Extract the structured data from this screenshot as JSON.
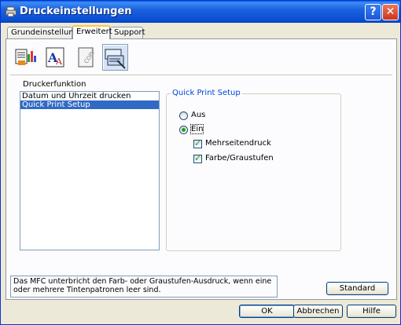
{
  "window": {
    "title": "Druckeinstellungen",
    "help_button": "?",
    "close_button": "✕"
  },
  "tabs": [
    {
      "label": "Grundeinstellungen",
      "active": false
    },
    {
      "label": "Erweitert",
      "active": true
    },
    {
      "label": "Support",
      "active": false
    }
  ],
  "toolbar_icons": [
    {
      "name": "printer-settings-icon",
      "selected": false
    },
    {
      "name": "font-text-icon",
      "selected": false
    },
    {
      "name": "copy-watermark-icon",
      "selected": false
    },
    {
      "name": "device-options-icon",
      "selected": true
    }
  ],
  "function_list": {
    "label": "Druckerfunktion",
    "items": [
      {
        "label": "Datum und Uhrzeit drucken",
        "selected": false
      },
      {
        "label": "Quick Print Setup",
        "selected": true
      }
    ]
  },
  "quick_print": {
    "group_title": "Quick Print Setup",
    "radio_off": "Aus",
    "radio_on": "Ein",
    "selected": "Ein",
    "check_multipage": "Mehrseitendruck",
    "check_multipage_checked": true,
    "check_color": "Farbe/Graustufen",
    "check_color_checked": true
  },
  "status": {
    "text": "Das MFC unterbricht den Farb- oder Graustufen-Ausdruck, wenn eine oder mehrere Tintenpatronen leer sind."
  },
  "buttons": {
    "standard": "Standard",
    "ok": "OK",
    "cancel": "Abbrechen",
    "help": "Hilfe"
  },
  "colors": {
    "titlebar": "#0a4fd2",
    "selection": "#316ac5",
    "group_title": "#0046d5",
    "check": "#21a121"
  }
}
